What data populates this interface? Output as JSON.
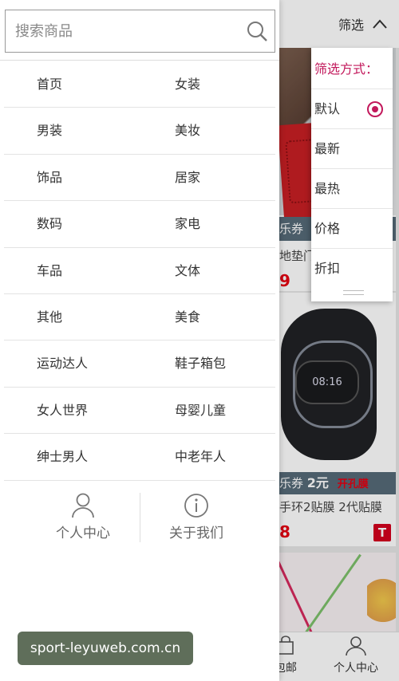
{
  "search": {
    "placeholder": "搜索商品"
  },
  "categories": [
    [
      "首页",
      "女装"
    ],
    [
      "男装",
      "美妆"
    ],
    [
      "饰品",
      "居家"
    ],
    [
      "数码",
      "家电"
    ],
    [
      "车品",
      "文体"
    ],
    [
      "其他",
      "美食"
    ],
    [
      "运动达人",
      "鞋子箱包"
    ],
    [
      "女人世界",
      "母婴儿童"
    ],
    [
      "绅士男人",
      "中老年人"
    ]
  ],
  "drawer_links": {
    "profile": "个人中心",
    "about": "关于我们"
  },
  "filter": {
    "toggle_label": "筛选",
    "title": "筛选方式：",
    "options": [
      "默认",
      "最新",
      "最热",
      "价格",
      "折扣"
    ],
    "selected": "默认"
  },
  "products": [
    {
      "coupon": "乐券",
      "title": "地垫门垫",
      "price": "9"
    },
    {
      "coupon": "乐券",
      "coupon_value": "2元",
      "tag": "开孔膜",
      "title": "手环2贴膜 2代贴膜",
      "price": "8",
      "screen_text": "08:16"
    }
  ],
  "bottom_nav": {
    "free_shipping": "包邮",
    "profile": "个人中心"
  },
  "watermark": "sport-leyuweb.com.cn",
  "colors": {
    "accent": "#c2185b",
    "price": "#e60012",
    "coupon_bar": "#566a78"
  }
}
